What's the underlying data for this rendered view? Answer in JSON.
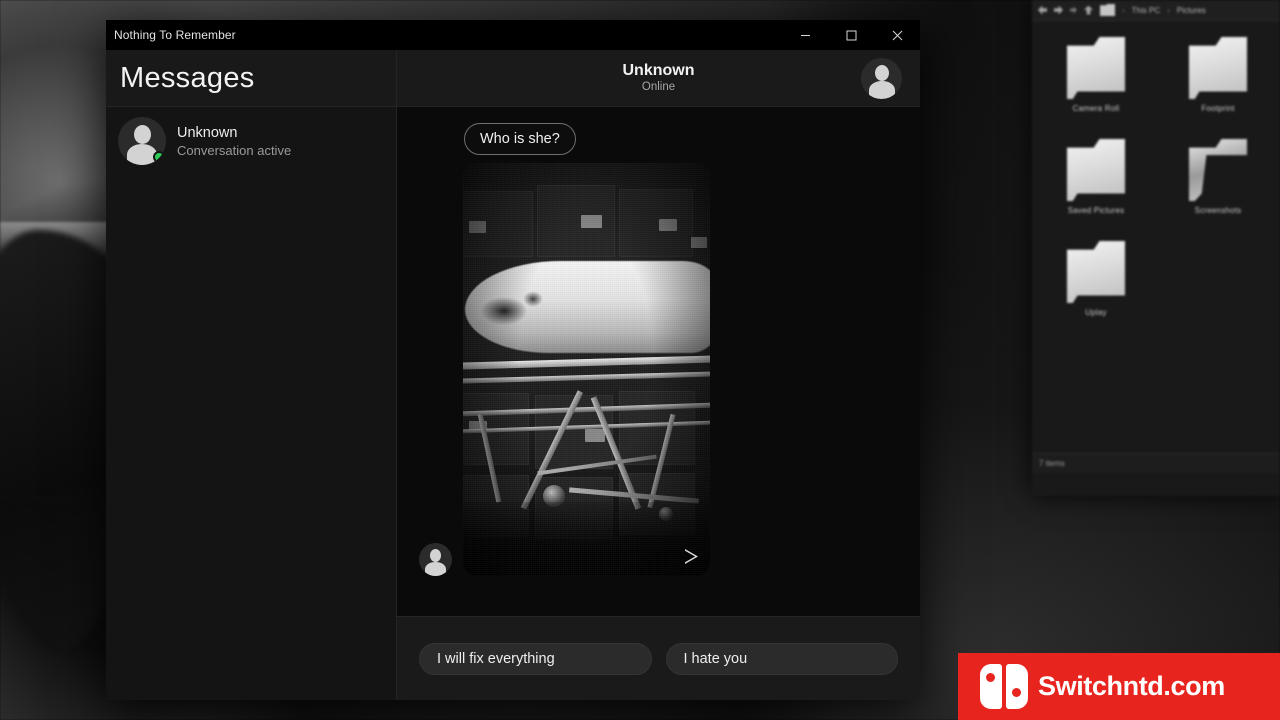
{
  "window": {
    "title": "Nothing To Remember",
    "controls": [
      {
        "name": "minimize",
        "glyph": "minimize-icon"
      },
      {
        "name": "maximize",
        "glyph": "maximize-icon"
      },
      {
        "name": "close",
        "glyph": "close-icon"
      }
    ]
  },
  "sidebar": {
    "heading": "Messages",
    "conversations": [
      {
        "name": "Unknown",
        "subtitle": "Conversation active",
        "online": true,
        "status_color": "#2ecc56"
      }
    ]
  },
  "chat": {
    "peer_name": "Unknown",
    "peer_status": "Online",
    "messages": [
      {
        "type": "text",
        "from": "self",
        "text": "Who is she?"
      },
      {
        "type": "media",
        "from": "peer",
        "caption": "",
        "has_play_control": true
      }
    ]
  },
  "composer": {
    "replies": [
      "I will fix everything",
      "I hate you"
    ]
  },
  "background_explorer": {
    "breadcrumb": [
      "This PC",
      "Pictures"
    ],
    "folders": [
      {
        "label": "Camera Roll",
        "open": false
      },
      {
        "label": "Footprint",
        "open": false
      },
      {
        "label": "Saved Pictures",
        "open": false
      },
      {
        "label": "Screenshots",
        "open": true
      },
      {
        "label": "Uplay",
        "open": false
      }
    ],
    "status": "7 items"
  },
  "watermark": {
    "text": "Switchntd.com",
    "brand_color": "#e8241f"
  }
}
